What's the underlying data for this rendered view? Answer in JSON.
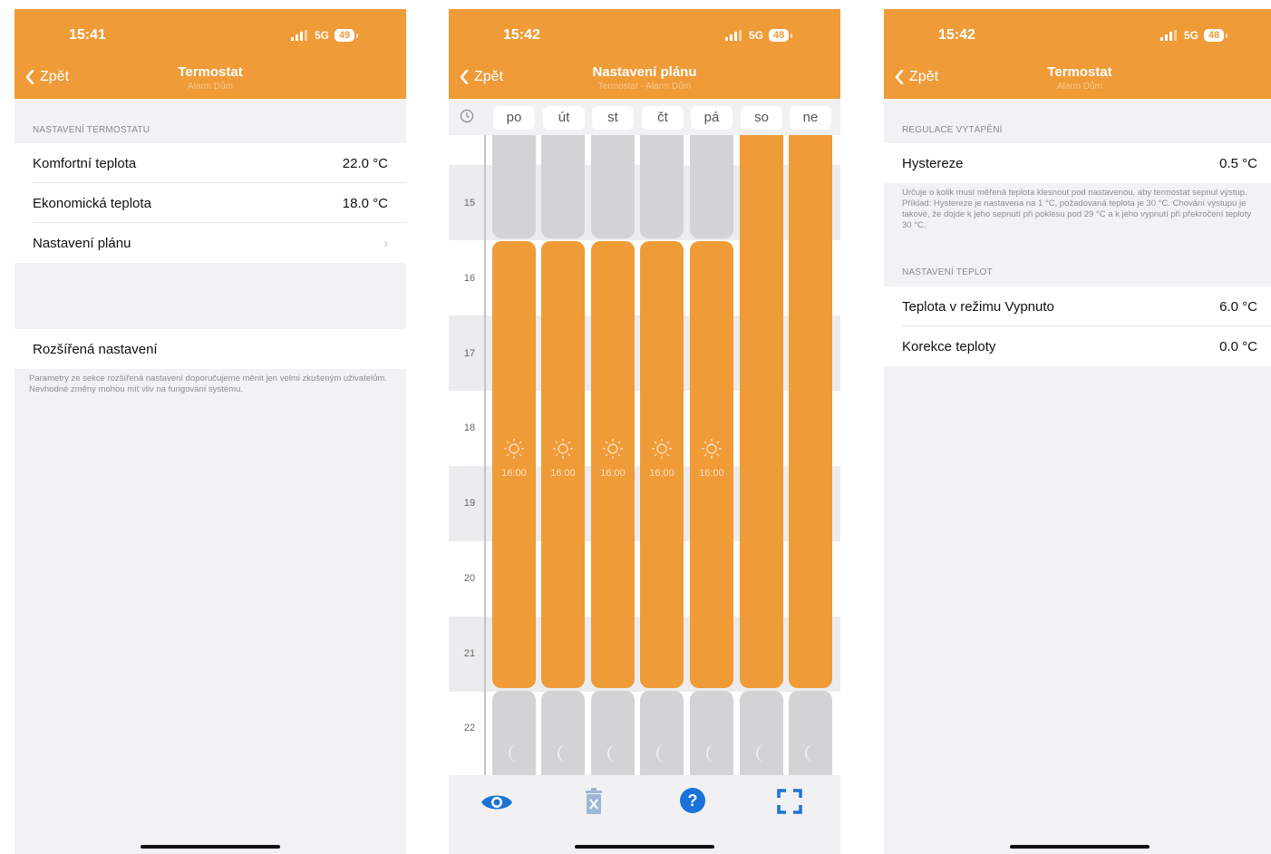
{
  "accent": "#ef9b38",
  "screen1": {
    "status": {
      "time": "15:41",
      "network": "5G",
      "battery": "49"
    },
    "nav": {
      "back": "Zpět",
      "title": "Termostat",
      "subtitle": "Alarm Dům"
    },
    "section": "NASTAVENÍ TERMOSTATU",
    "rows": [
      {
        "label": "Komfortní teplota",
        "value": "22.0 °C"
      },
      {
        "label": "Ekonomická teplota",
        "value": "18.0 °C"
      },
      {
        "label": "Nastavení plánu"
      }
    ],
    "advanced": {
      "label": "Rozšířená nastavení",
      "note": "Parametry ze sekce rozšířená nastavení doporučujeme měnit jen velmi zkušeným uživatelům. Nevhodné změny mohou mít vliv na fungování systému."
    }
  },
  "screen2": {
    "status": {
      "time": "15:42",
      "network": "5G",
      "battery": "48"
    },
    "nav": {
      "back": "Zpět",
      "title": "Nastavení plánu",
      "subtitle": "Termostat - Alarm Dům"
    },
    "days": [
      "po",
      "út",
      "st",
      "čt",
      "pá",
      "so",
      "ne"
    ],
    "hours": [
      "15",
      "16",
      "17",
      "18",
      "19",
      "20",
      "21",
      "22"
    ],
    "comfort_start_label": "16:00",
    "icons": {
      "eye": "eye-icon",
      "delete": "trash-icon",
      "help": "help-icon",
      "fullscreen": "fullscreen-icon"
    }
  },
  "screen3": {
    "status": {
      "time": "15:42",
      "network": "5G",
      "battery": "48"
    },
    "nav": {
      "back": "Zpět",
      "title": "Termostat",
      "subtitle": "Alarm Dům"
    },
    "section1": "REGULACE VYTÁPĚNÍ",
    "hysteresis": {
      "label": "Hystereze",
      "value": "0.5 °C"
    },
    "note": "Určuje o kolik musí měřená teplota klesnout pod nastavenou, aby termostat sepnul výstup. Příklad: Hystereze je nastavena na 1 °C, požadovaná teplota je 30 °C. Chování výstupu je takové, že dojde k jeho sepnutí při poklesu pod 29 °C a k jeho vypnutí při překročení teploty 30 °C.",
    "section2": "NASTAVENÍ TEPLOT",
    "rows": [
      {
        "label": "Teplota v režimu Vypnuto",
        "value": "6.0 °C"
      },
      {
        "label": "Korekce teploty",
        "value": "0.0 °C"
      }
    ]
  }
}
